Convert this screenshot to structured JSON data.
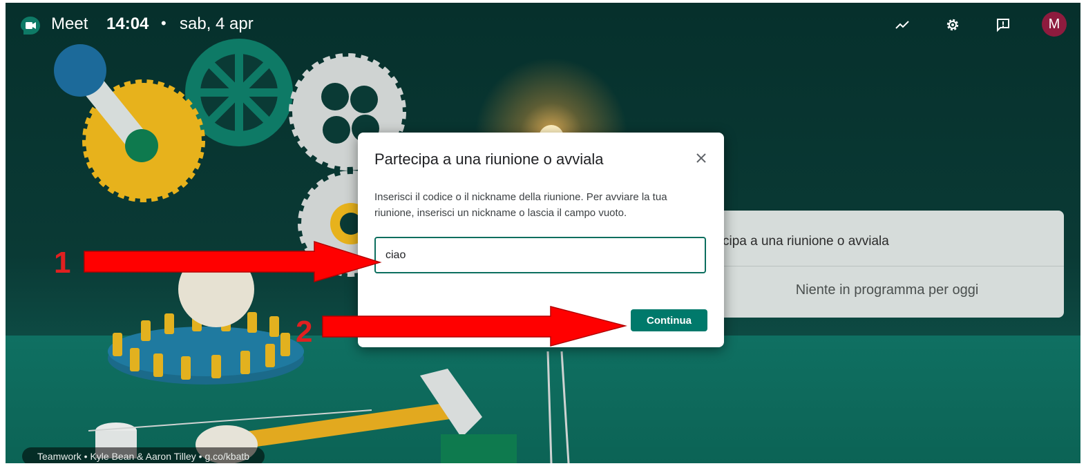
{
  "topbar": {
    "brand": "Meet",
    "time": "14:04",
    "separator": "•",
    "date": "sab, 4 apr",
    "avatar_initial": "M",
    "icons": [
      "stats-icon",
      "gear-icon",
      "feedback-icon"
    ]
  },
  "background_card": {
    "join_text": "cipa a una riunione o avviala",
    "empty_schedule": "Niente in programma per oggi"
  },
  "caption": "Teamwork • Kyle Bean & Aaron Tilley • g.co/kbatb",
  "dialog": {
    "title": "Partecipa a una riunione o avviala",
    "description": "Inserisci il codice o il nickname della riunione. Per avviare la tua riunione, inserisci un nickname o lascia il campo vuoto.",
    "input_value": "ciao",
    "continue_label": "Continua"
  },
  "annotations": {
    "step1": "1",
    "step2": "2",
    "color": "#e02020"
  },
  "colors": {
    "accent": "#00796b",
    "avatar": "#8e1b3e"
  }
}
